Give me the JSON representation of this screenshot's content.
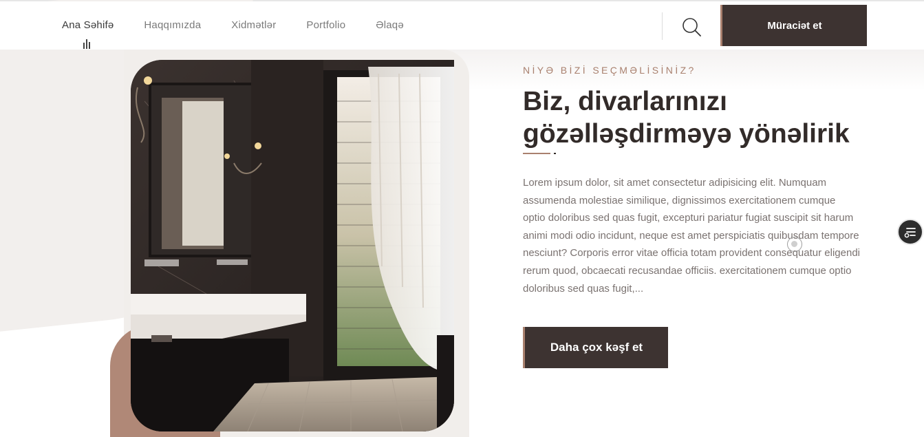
{
  "header": {
    "nav": [
      {
        "label": "Ana Səhifə",
        "active": true
      },
      {
        "label": "Haqqımızda",
        "active": false
      },
      {
        "label": "Xidmətlər",
        "active": false
      },
      {
        "label": "Portfolio",
        "active": false
      },
      {
        "label": "Əlaqə",
        "active": false
      }
    ],
    "search_icon": "search-icon",
    "cta_label": "Müraciət et"
  },
  "hero": {
    "kicker": "NİYƏ BİZİ SEÇMƏLİSİNİZ?",
    "title_line1": "Biz, divarlarınızı",
    "title_line2": "gözəlləşdirməyə yönəlirik",
    "body": "Lorem ipsum dolor, sit amet consectetur adipisicing elit. Numquam assumenda molestiae similique, dignissimos exercitationem cumque optio doloribus sed quas fugit, excepturi pariatur fugiat suscipit sit harum animi modi odio incidunt, neque est amet perspiciatis quibusdam tempore nesciunt? Corporis error vitae officia totam provident consequatur eligendi rerum quod, obcaecati recusandae officiis. exercitationem cumque optio doloribus sed quas fugit,...",
    "cta_label": "Daha çox kəşf et",
    "image_icon": "bathroom-photo"
  },
  "side_widget": {
    "icon": "settings-list-icon"
  },
  "colors": {
    "dark": "#3d3331",
    "accent": "#a9806e",
    "panel": "#f1eeeb",
    "text_muted": "#7a7270"
  }
}
